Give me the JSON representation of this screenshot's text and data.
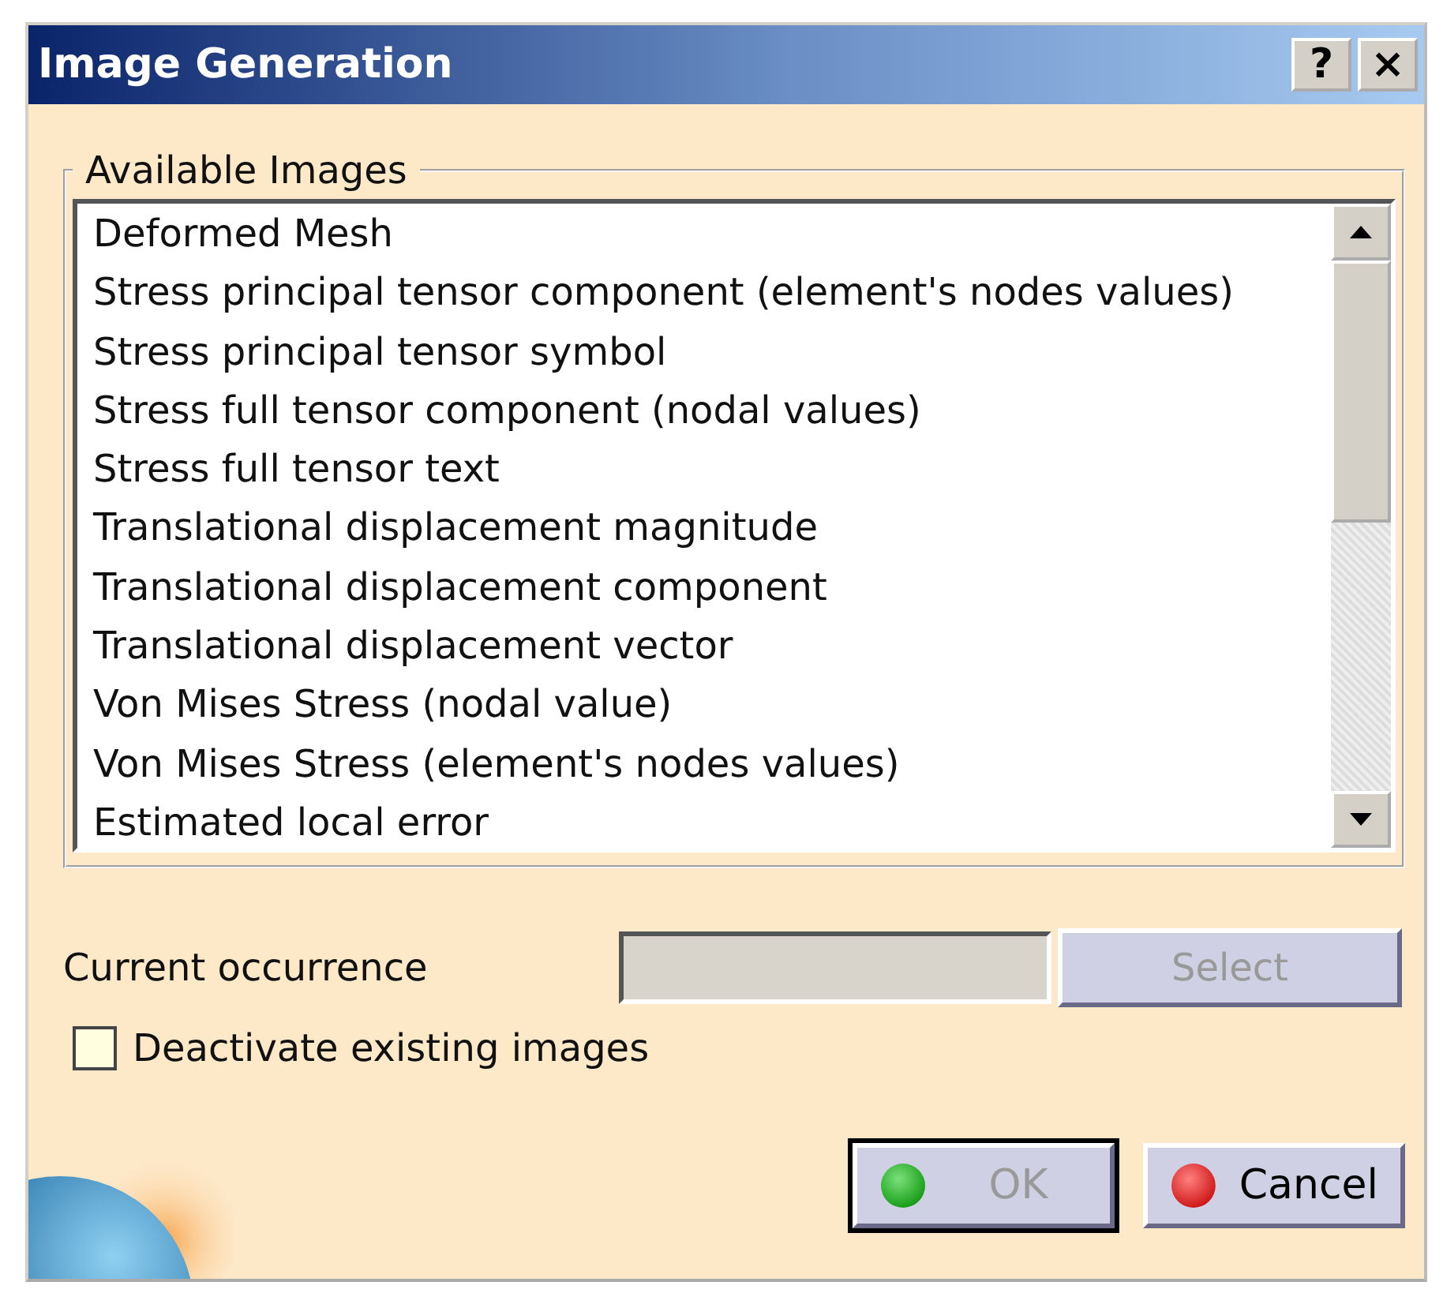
{
  "window": {
    "title": "Image Generation",
    "help_button": "?",
    "close_button": "×"
  },
  "available_images": {
    "legend": "Available Images",
    "items": [
      {
        "label": "Deformed Mesh",
        "selected": false
      },
      {
        "label": "Stress principal tensor component (element's nodes values)",
        "selected": false
      },
      {
        "label": "Stress principal tensor symbol",
        "selected": false
      },
      {
        "label": "Stress full tensor component (nodal values)",
        "selected": false
      },
      {
        "label": "Stress full tensor text",
        "selected": false
      },
      {
        "label": "Translational displacement magnitude",
        "selected": false
      },
      {
        "label": "Translational displacement component",
        "selected": false
      },
      {
        "label": "Translational displacement vector",
        "selected": false
      },
      {
        "label": "Von Mises Stress (nodal value)",
        "selected": false
      },
      {
        "label": "Von Mises Stress (element's nodes values)",
        "selected": false
      },
      {
        "label": "Estimated local error",
        "selected": false
      }
    ]
  },
  "current_occurrence": {
    "label": "Current occurrence",
    "disabled": true,
    "select_button": {
      "label": "Select",
      "disabled": true
    }
  },
  "deactivate_checkbox": {
    "label": "Deactivate existing images",
    "checked": false
  },
  "buttons": [
    {
      "kind": "ok",
      "label": "OK",
      "disabled": true,
      "default": true
    },
    {
      "kind": "cancel",
      "label": "Cancel",
      "disabled": false,
      "default": false
    }
  ]
}
